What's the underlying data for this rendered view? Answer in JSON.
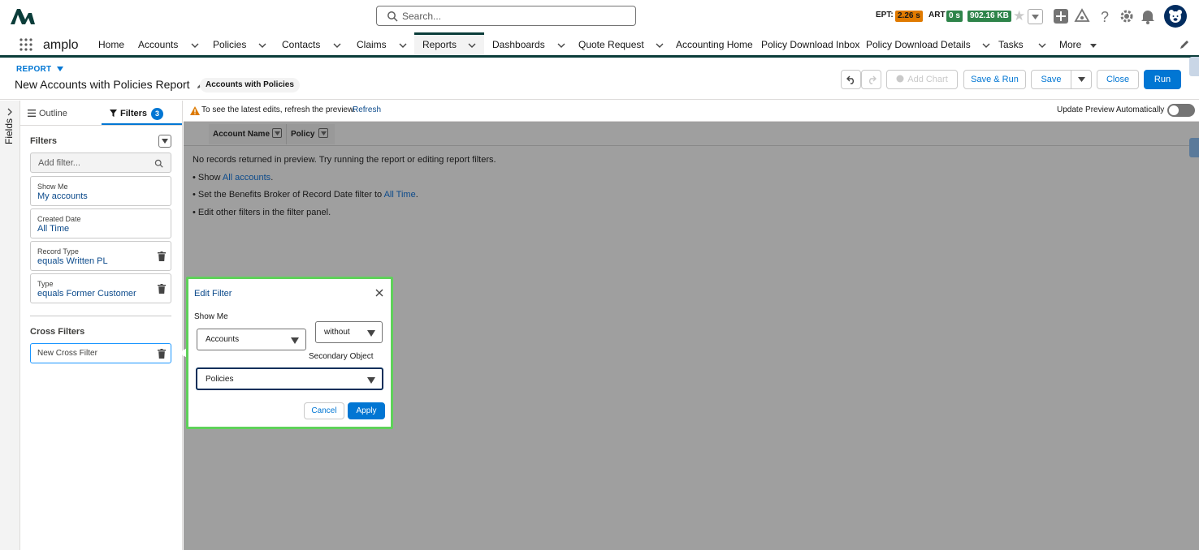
{
  "global": {
    "search_placeholder": "Search...",
    "ept_label": "EPT:",
    "ept_value": "2.26 s",
    "art_label": "ART",
    "art_value": "0 s",
    "size_value": "902.16 KB",
    "colors": {
      "ept": "#e07a00",
      "art": "#2e844a",
      "size": "#2e844a"
    },
    "icons": [
      "add-icon",
      "trailhead-icon",
      "help-icon",
      "setup-gear-icon",
      "notification-bell-icon"
    ]
  },
  "nav": {
    "app_name": "amplo",
    "items": [
      {
        "label": "Home",
        "dropdown": false
      },
      {
        "label": "Accounts",
        "dropdown": true
      },
      {
        "label": "Policies",
        "dropdown": true
      },
      {
        "label": "Contacts",
        "dropdown": true
      },
      {
        "label": "Claims",
        "dropdown": true
      },
      {
        "label": "Reports",
        "dropdown": true,
        "active": true
      },
      {
        "label": "Dashboards",
        "dropdown": true
      },
      {
        "label": "Quote Request",
        "dropdown": true
      },
      {
        "label": "Accounting Home",
        "dropdown": false
      },
      {
        "label": "Policy Download Inbox",
        "dropdown": false
      },
      {
        "label": "Policy Download Details",
        "dropdown": true
      },
      {
        "label": "Tasks",
        "dropdown": true
      },
      {
        "label": "More",
        "dropdown": true
      }
    ]
  },
  "report": {
    "label": "REPORT",
    "title": "New Accounts with Policies Report",
    "type_pill": "Accounts with Policies",
    "buttons": {
      "add_chart": "Add Chart",
      "save_run": "Save & Run",
      "save": "Save",
      "close": "Close",
      "run": "Run"
    }
  },
  "left": {
    "fields_rail": "Fields",
    "tabs": {
      "outline": "Outline",
      "filters": "Filters",
      "filters_count": "3"
    },
    "filters_title": "Filters",
    "add_filter_placeholder": "Add filter...",
    "filters": [
      {
        "label": "Show Me",
        "value": "My accounts",
        "removable": false
      },
      {
        "label": "Created Date",
        "value": "All Time",
        "removable": false
      },
      {
        "label": "Record Type",
        "value": "equals Written PL",
        "removable": true
      },
      {
        "label": "Type",
        "value": "equals Former Customer",
        "removable": true
      }
    ],
    "cross_filters_title": "Cross Filters",
    "cross_filter_item": "New Cross Filter"
  },
  "main": {
    "info_text": "To see the latest edits, refresh the preview.",
    "refresh_link": "Refresh",
    "auto_update_label": "Update Preview Automatically",
    "columns": [
      "Account Name",
      "Policy"
    ],
    "no_records": "No records returned in preview. Try running the report or editing report filters.",
    "bullet1_pre": "• Show ",
    "bullet1_link": "All accounts",
    "bullet1_post": ".",
    "bullet2_pre": "• Set the Benefits Broker of Record Date filter to ",
    "bullet2_link": "All Time",
    "bullet2_post": ".",
    "bullet3": "• Edit other filters in the filter panel."
  },
  "edit_filter": {
    "title": "Edit Filter",
    "show_me_label": "Show Me",
    "primary_object": "Accounts",
    "operator": "without",
    "secondary_label": "Secondary Object",
    "secondary_object": "Policies",
    "cancel": "Cancel",
    "apply": "Apply"
  }
}
